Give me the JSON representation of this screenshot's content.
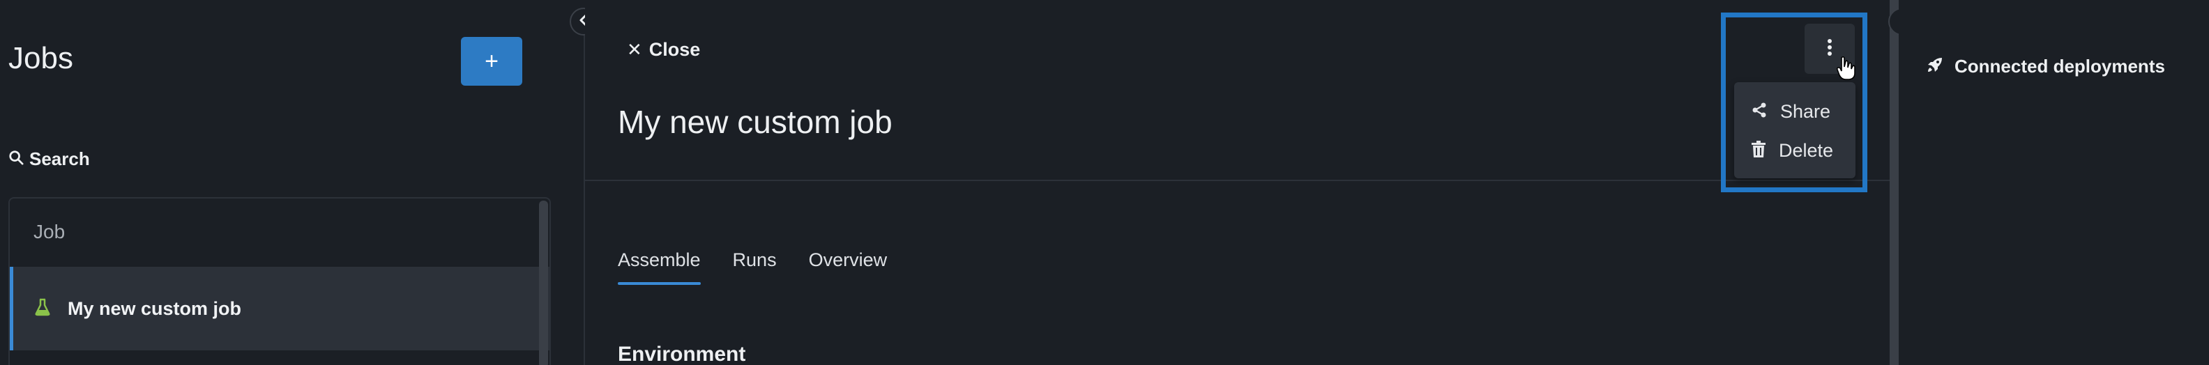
{
  "sidebar": {
    "title": "Jobs",
    "add_button_label": "+",
    "search_label": "Search",
    "list_header": "Job",
    "jobs": [
      {
        "name": "My new custom job",
        "icon": "flask-icon",
        "selected": true
      }
    ]
  },
  "main": {
    "close_label": "Close",
    "job_title": "My new custom job",
    "tabs": [
      {
        "label": "Assemble",
        "active": true
      },
      {
        "label": "Runs",
        "active": false
      },
      {
        "label": "Overview",
        "active": false
      }
    ],
    "section_heading": "Environment",
    "menu": {
      "items": [
        {
          "label": "Share",
          "icon": "share-icon"
        },
        {
          "label": "Delete",
          "icon": "trash-icon"
        }
      ]
    }
  },
  "right_panel": {
    "connected_label": "Connected deployments",
    "icon": "rocket-icon"
  },
  "colors": {
    "background": "#1b1f25",
    "accent": "#2d7bc4",
    "highlight": "#2277c6",
    "flask": "#8bc34a",
    "selected_row": "#2c3139"
  }
}
